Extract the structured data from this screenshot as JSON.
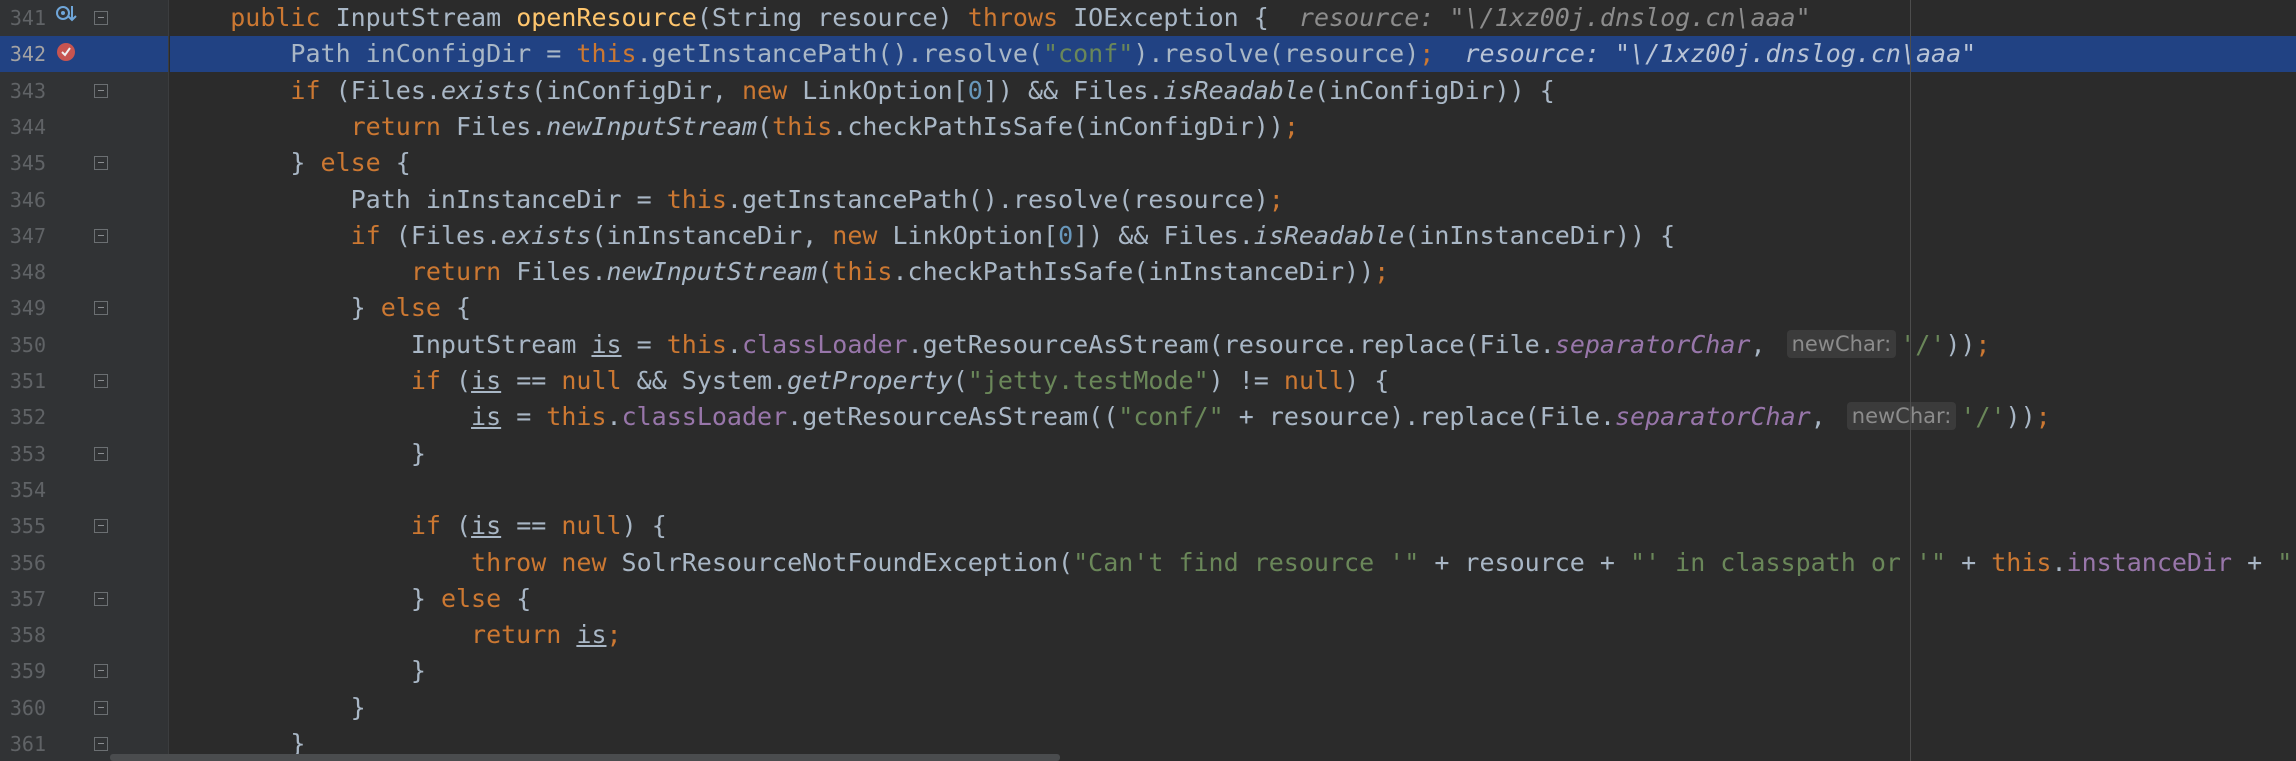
{
  "editor": {
    "language": "java",
    "highlighted_line": "342",
    "lines": [
      {
        "num": "341",
        "icons": [
          "breakpoint-step-icon"
        ],
        "fold": "open",
        "tokens": [
          {
            "t": "    "
          },
          {
            "t": "public ",
            "c": "kw"
          },
          {
            "t": "InputStream "
          },
          {
            "t": "openResource",
            "c": "fn"
          },
          {
            "t": "(String resource) "
          },
          {
            "t": "throws ",
            "c": "kw"
          },
          {
            "t": "IOException {"
          },
          {
            "t": "  resource: \"\\/1xz00j.dnslog.cn\\aaa\"",
            "c": "inl"
          }
        ]
      },
      {
        "num": "342",
        "icons": [
          "breakpoint-icon"
        ],
        "fold": "none",
        "highlight": true,
        "tokens": [
          {
            "t": "        Path inConfigDir = "
          },
          {
            "t": "this",
            "c": "kw"
          },
          {
            "t": ".getInstancePath().resolve("
          },
          {
            "t": "\"conf\"",
            "c": "str"
          },
          {
            "t": ").resolve(resource)"
          },
          {
            "t": ";",
            "c": "kw"
          },
          {
            "t": "  resource: \"\\/1xz00j.dnslog.cn\\aaa\"",
            "c": "inl-hl"
          }
        ]
      },
      {
        "num": "343",
        "icons": [],
        "fold": "open",
        "tokens": [
          {
            "t": "        "
          },
          {
            "t": "if ",
            "c": "kw"
          },
          {
            "t": "(Files."
          },
          {
            "t": "exists",
            "c": "it"
          },
          {
            "t": "(inConfigDir, "
          },
          {
            "t": "new ",
            "c": "kw"
          },
          {
            "t": "LinkOption["
          },
          {
            "t": "0",
            "c": "num"
          },
          {
            "t": "]) && Files."
          },
          {
            "t": "isReadable",
            "c": "it"
          },
          {
            "t": "(inConfigDir)) {"
          }
        ]
      },
      {
        "num": "344",
        "icons": [],
        "fold": "none",
        "tokens": [
          {
            "t": "            "
          },
          {
            "t": "return ",
            "c": "kw"
          },
          {
            "t": "Files."
          },
          {
            "t": "newInputStream",
            "c": "it"
          },
          {
            "t": "("
          },
          {
            "t": "this",
            "c": "kw"
          },
          {
            "t": ".checkPathIsSafe(inConfigDir))"
          },
          {
            "t": ";",
            "c": "kw"
          }
        ]
      },
      {
        "num": "345",
        "icons": [],
        "fold": "close",
        "tokens": [
          {
            "t": "        } "
          },
          {
            "t": "else ",
            "c": "kw"
          },
          {
            "t": "{"
          }
        ]
      },
      {
        "num": "346",
        "icons": [],
        "fold": "none",
        "tokens": [
          {
            "t": "            Path inInstanceDir = "
          },
          {
            "t": "this",
            "c": "kw"
          },
          {
            "t": ".getInstancePath().resolve(resource)"
          },
          {
            "t": ";",
            "c": "kw"
          }
        ]
      },
      {
        "num": "347",
        "icons": [],
        "fold": "open",
        "tokens": [
          {
            "t": "            "
          },
          {
            "t": "if ",
            "c": "kw"
          },
          {
            "t": "(Files."
          },
          {
            "t": "exists",
            "c": "it"
          },
          {
            "t": "(inInstanceDir, "
          },
          {
            "t": "new ",
            "c": "kw"
          },
          {
            "t": "LinkOption["
          },
          {
            "t": "0",
            "c": "num"
          },
          {
            "t": "]) && Files."
          },
          {
            "t": "isReadable",
            "c": "it"
          },
          {
            "t": "(inInstanceDir)) {"
          }
        ]
      },
      {
        "num": "348",
        "icons": [],
        "fold": "none",
        "tokens": [
          {
            "t": "                "
          },
          {
            "t": "return ",
            "c": "kw"
          },
          {
            "t": "Files."
          },
          {
            "t": "newInputStream",
            "c": "it"
          },
          {
            "t": "("
          },
          {
            "t": "this",
            "c": "kw"
          },
          {
            "t": ".checkPathIsSafe(inInstanceDir))"
          },
          {
            "t": ";",
            "c": "kw"
          }
        ]
      },
      {
        "num": "349",
        "icons": [],
        "fold": "close",
        "tokens": [
          {
            "t": "            } "
          },
          {
            "t": "else ",
            "c": "kw"
          },
          {
            "t": "{"
          }
        ]
      },
      {
        "num": "350",
        "icons": [],
        "fold": "none",
        "tokens": [
          {
            "t": "                InputStream "
          },
          {
            "t": "is",
            "c": "ul"
          },
          {
            "t": " = "
          },
          {
            "t": "this",
            "c": "kw"
          },
          {
            "t": "."
          },
          {
            "t": "classLoader",
            "c": "fld"
          },
          {
            "t": ".getResourceAsStream(resource.replace(File."
          },
          {
            "t": "separatorChar",
            "c": "itf"
          },
          {
            "t": ", "
          },
          {
            "t": "newChar:",
            "c": "hint"
          },
          {
            "t": "'/'",
            "c": "str"
          },
          {
            "t": "))"
          },
          {
            "t": ";",
            "c": "kw"
          }
        ]
      },
      {
        "num": "351",
        "icons": [],
        "fold": "open",
        "tokens": [
          {
            "t": "                "
          },
          {
            "t": "if ",
            "c": "kw"
          },
          {
            "t": "("
          },
          {
            "t": "is",
            "c": "ul"
          },
          {
            "t": " == "
          },
          {
            "t": "null ",
            "c": "kw"
          },
          {
            "t": "&& System."
          },
          {
            "t": "getProperty",
            "c": "it"
          },
          {
            "t": "("
          },
          {
            "t": "\"jetty.testMode\"",
            "c": "str"
          },
          {
            "t": ") != "
          },
          {
            "t": "null",
            "c": "kw"
          },
          {
            "t": ") {"
          }
        ]
      },
      {
        "num": "352",
        "icons": [],
        "fold": "none",
        "tokens": [
          {
            "t": "                    "
          },
          {
            "t": "is",
            "c": "ul"
          },
          {
            "t": " = "
          },
          {
            "t": "this",
            "c": "kw"
          },
          {
            "t": "."
          },
          {
            "t": "classLoader",
            "c": "fld"
          },
          {
            "t": ".getResourceAsStream(("
          },
          {
            "t": "\"conf/\"",
            "c": "str"
          },
          {
            "t": " + resource).replace(File."
          },
          {
            "t": "separatorChar",
            "c": "itf"
          },
          {
            "t": ", "
          },
          {
            "t": "newChar:",
            "c": "hint"
          },
          {
            "t": "'/'",
            "c": "str"
          },
          {
            "t": "))"
          },
          {
            "t": ";",
            "c": "kw"
          }
        ]
      },
      {
        "num": "353",
        "icons": [],
        "fold": "close",
        "tokens": [
          {
            "t": "                }"
          }
        ]
      },
      {
        "num": "354",
        "icons": [],
        "fold": "none",
        "tokens": [
          {
            "t": ""
          }
        ]
      },
      {
        "num": "355",
        "icons": [],
        "fold": "open",
        "tokens": [
          {
            "t": "                "
          },
          {
            "t": "if ",
            "c": "kw"
          },
          {
            "t": "("
          },
          {
            "t": "is",
            "c": "ul"
          },
          {
            "t": " == "
          },
          {
            "t": "null",
            "c": "kw"
          },
          {
            "t": ") {"
          }
        ]
      },
      {
        "num": "356",
        "icons": [],
        "fold": "none",
        "tokens": [
          {
            "t": "                    "
          },
          {
            "t": "throw new ",
            "c": "kw"
          },
          {
            "t": "SolrResourceNotFoundException("
          },
          {
            "t": "\"Can't find resource '\"",
            "c": "str"
          },
          {
            "t": " + resource + "
          },
          {
            "t": "\"' in classpath or '\"",
            "c": "str"
          },
          {
            "t": " + "
          },
          {
            "t": "this",
            "c": "kw"
          },
          {
            "t": "."
          },
          {
            "t": "instanceDir",
            "c": "fld"
          },
          {
            "t": " + "
          },
          {
            "t": "\"'\"",
            "c": "str"
          },
          {
            "t": ")"
          },
          {
            "t": ";",
            "c": "kw"
          }
        ]
      },
      {
        "num": "357",
        "icons": [],
        "fold": "close",
        "tokens": [
          {
            "t": "                } "
          },
          {
            "t": "else ",
            "c": "kw"
          },
          {
            "t": "{"
          }
        ]
      },
      {
        "num": "358",
        "icons": [],
        "fold": "none",
        "tokens": [
          {
            "t": "                    "
          },
          {
            "t": "return ",
            "c": "kw"
          },
          {
            "t": "is",
            "c": "ul"
          },
          {
            "t": ";",
            "c": "kw"
          }
        ]
      },
      {
        "num": "359",
        "icons": [],
        "fold": "close",
        "tokens": [
          {
            "t": "                }"
          }
        ]
      },
      {
        "num": "360",
        "icons": [],
        "fold": "close",
        "tokens": [
          {
            "t": "            }"
          }
        ]
      },
      {
        "num": "361",
        "icons": [],
        "fold": "close",
        "tokens": [
          {
            "t": "        }"
          }
        ]
      }
    ]
  },
  "colors": {
    "background": "#2b2b2b",
    "gutter": "#313335",
    "highlight": "#214283",
    "keyword": "#cc7832",
    "method_decl": "#ffc66d",
    "string": "#6a8759",
    "number": "#6897bb",
    "field": "#9876aa",
    "text": "#a9b7c6",
    "breakpoint": "#c75450"
  }
}
